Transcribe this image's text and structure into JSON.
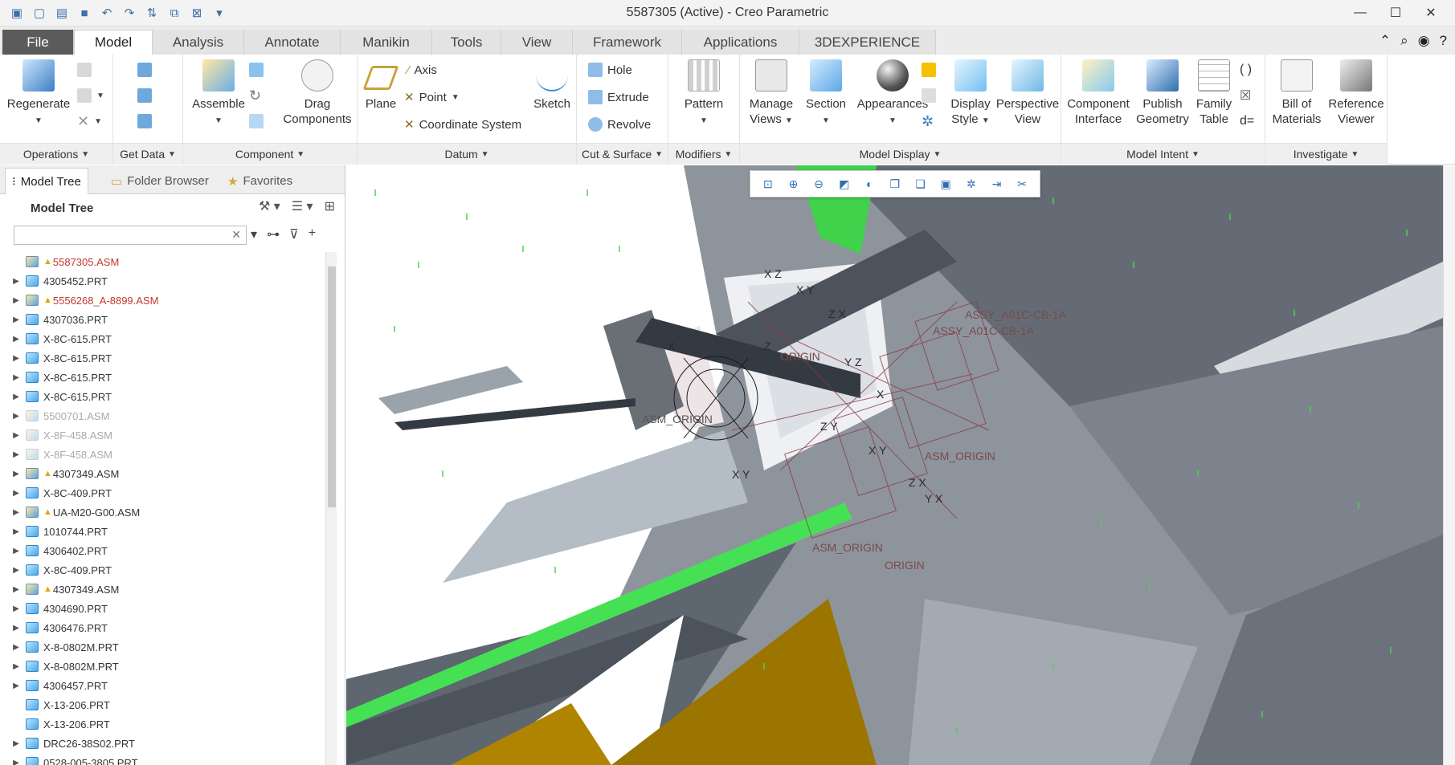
{
  "window": {
    "title": "5587305 (Active) - Creo Parametric"
  },
  "tabs": [
    "File",
    "Model",
    "Analysis",
    "Annotate",
    "Manikin",
    "Tools",
    "View",
    "Framework",
    "Applications",
    "3DEXPERIENCE"
  ],
  "ribbon": {
    "groups": {
      "operations": "Operations",
      "get_data": "Get Data",
      "component": "Component",
      "datum": "Datum",
      "cut_surface": "Cut & Surface",
      "modifiers": "Modifiers",
      "model_display": "Model Display",
      "model_intent": "Model Intent",
      "investigate": "Investigate"
    },
    "buttons": {
      "regenerate": "Regenerate",
      "assemble": "Assemble",
      "drag_components_1": "Drag",
      "drag_components_2": "Components",
      "plane": "Plane",
      "axis": "Axis",
      "point": "Point",
      "coordinate_system": "Coordinate System",
      "sketch": "Sketch",
      "hole": "Hole",
      "extrude": "Extrude",
      "revolve": "Revolve",
      "pattern": "Pattern",
      "manage_views_1": "Manage",
      "manage_views_2": "Views",
      "section": "Section",
      "appearances": "Appearances",
      "display_style_1": "Display",
      "display_style_2": "Style",
      "perspective_view_1": "Perspective",
      "perspective_view_2": "View",
      "component_interface_1": "Component",
      "component_interface_2": "Interface",
      "publish_geometry_1": "Publish",
      "publish_geometry_2": "Geometry",
      "family_table_1": "Family",
      "family_table_2": "Table",
      "bom_1": "Bill of",
      "bom_2": "Materials",
      "reference_viewer_1": "Reference",
      "reference_viewer_2": "Viewer"
    }
  },
  "panel": {
    "tabs": {
      "model_tree": "Model Tree",
      "folder_browser": "Folder Browser",
      "favorites": "Favorites"
    },
    "header": "Model Tree",
    "search_placeholder": "",
    "items": [
      {
        "name": "5587305.ASM",
        "state": "red-warn",
        "expand": ""
      },
      {
        "name": "4305452.PRT",
        "state": "normal",
        "expand": "▶"
      },
      {
        "name": "5556268_A-8899.ASM",
        "state": "red-warn",
        "expand": "▶"
      },
      {
        "name": "4307036.PRT",
        "state": "normal",
        "expand": "▶"
      },
      {
        "name": "X-8C-615.PRT",
        "state": "normal",
        "expand": "▶"
      },
      {
        "name": "X-8C-615.PRT",
        "state": "normal",
        "expand": "▶"
      },
      {
        "name": "X-8C-615.PRT",
        "state": "normal",
        "expand": "▶"
      },
      {
        "name": "X-8C-615.PRT",
        "state": "normal",
        "expand": "▶"
      },
      {
        "name": "5500701.ASM",
        "state": "dim",
        "expand": "▶"
      },
      {
        "name": "X-8F-458.ASM",
        "state": "dim",
        "expand": "▶"
      },
      {
        "name": "X-8F-458.ASM",
        "state": "dim",
        "expand": "▶"
      },
      {
        "name": "4307349.ASM",
        "state": "warn",
        "expand": "▶"
      },
      {
        "name": "X-8C-409.PRT",
        "state": "normal",
        "expand": "▶"
      },
      {
        "name": "UA-M20-G00.ASM",
        "state": "warn",
        "expand": "▶"
      },
      {
        "name": "1010744.PRT",
        "state": "normal",
        "expand": "▶"
      },
      {
        "name": "4306402.PRT",
        "state": "normal",
        "expand": "▶"
      },
      {
        "name": "X-8C-409.PRT",
        "state": "normal",
        "expand": "▶"
      },
      {
        "name": "4307349.ASM",
        "state": "warn",
        "expand": "▶"
      },
      {
        "name": "4304690.PRT",
        "state": "normal",
        "expand": "▶"
      },
      {
        "name": "4306476.PRT",
        "state": "normal",
        "expand": "▶"
      },
      {
        "name": "X-8-0802M.PRT",
        "state": "normal",
        "expand": "▶"
      },
      {
        "name": "X-8-0802M.PRT",
        "state": "normal",
        "expand": "▶"
      },
      {
        "name": "4306457.PRT",
        "state": "normal",
        "expand": "▶"
      },
      {
        "name": "X-13-206.PRT",
        "state": "normal",
        "expand": ""
      },
      {
        "name": "X-13-206.PRT",
        "state": "normal",
        "expand": ""
      },
      {
        "name": "DRC26-38S02.PRT",
        "state": "normal",
        "expand": "▶"
      },
      {
        "name": "0528-005-3805.PRT",
        "state": "normal",
        "expand": "▶"
      }
    ]
  },
  "viewport": {
    "labels": {
      "asm_origin_left": "ASM_ORIGIN",
      "asm_origin_right": "ASM_ORIGIN",
      "asm_origin_bottom": "ASM_ORIGIN",
      "origin_top": "ORIGIN",
      "origin_bottom": "ORIGIN",
      "assy_label": "ASSY_A01C-CB-1A",
      "assy_label2": "ASSY_A01C-CB-1A"
    }
  }
}
